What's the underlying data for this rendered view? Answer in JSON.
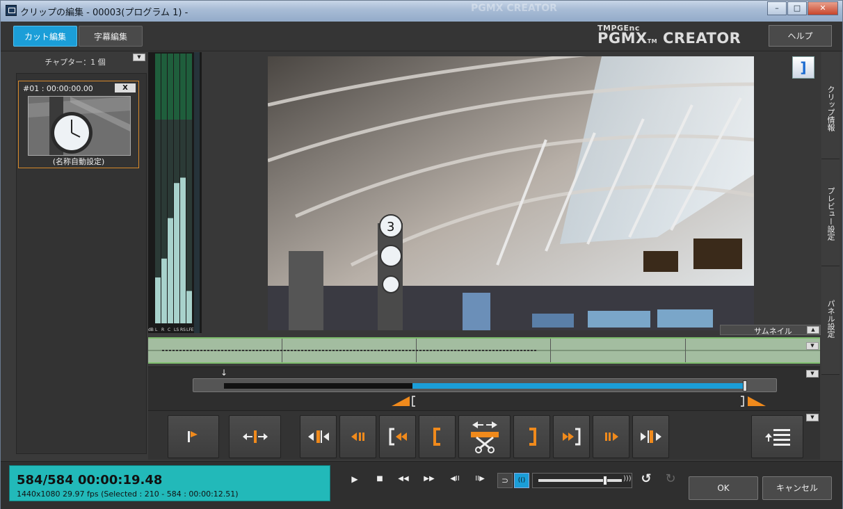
{
  "window": {
    "title": "クリップの編集 - 00003(プログラム 1) -",
    "background_watermarks": [
      "PGMX CREATOR"
    ]
  },
  "toolbar": {
    "tab_cut_label": "カット編集",
    "tab_subtitle_label": "字幕編集",
    "logo_line1": "TMPGEnc",
    "logo_line2": "PGMX",
    "logo_tm": "TM",
    "logo_line3": "CREATOR",
    "help_label": "ヘルプ"
  },
  "chapters": {
    "title": "チャプター：1 個",
    "items": [
      {
        "header": "#01 : 00:00:00.00",
        "close_label": "X",
        "name": "(名称自動設定)"
      }
    ]
  },
  "meter": {
    "scale_label": "dB",
    "channel_labels": [
      "L",
      "R",
      "C",
      "LS",
      "RS",
      "LFE"
    ],
    "levels": [
      0.17,
      0.24,
      0.39,
      0.52,
      0.54,
      0.12
    ]
  },
  "preview": {
    "mark_out_glyph": "]",
    "thumbnail_tab_label": "サムネイル"
  },
  "side_tabs": [
    "クリップ情報",
    "プレビュー設定",
    "パネル設定"
  ],
  "timeline": {
    "selection_start_fraction": 0.36,
    "selection_end_fraction": 1.0,
    "cursor_fraction": 1.0
  },
  "edit_buttons": [
    {
      "name": "set-chapter-button",
      "icon": "flag-icon"
    },
    {
      "name": "split-button",
      "icon": "split-arrows-icon"
    },
    {
      "name": "prev-cut-button",
      "icon": "prev-cut-icon"
    },
    {
      "name": "step-back-button",
      "icon": "step-back-icon"
    },
    {
      "name": "go-start-button",
      "icon": "go-start-icon"
    },
    {
      "name": "set-start-button",
      "icon": "bracket-open-icon"
    },
    {
      "name": "cut-button",
      "icon": "scissors-icon"
    },
    {
      "name": "set-end-button",
      "icon": "bracket-close-icon"
    },
    {
      "name": "go-end-button",
      "icon": "go-end-icon"
    },
    {
      "name": "step-forward-button",
      "icon": "step-forward-icon"
    },
    {
      "name": "next-cut-button",
      "icon": "next-cut-icon"
    },
    {
      "name": "list-button",
      "icon": "list-icon"
    }
  ],
  "status": {
    "frame_time": "584/584  00:00:19.48",
    "info": "1440x1080 29.97 fps  (Selected : 210 - 584 : 00:00:12.51)"
  },
  "playback": {
    "buttons": [
      {
        "name": "play-button",
        "glyph": "▶"
      },
      {
        "name": "stop-button",
        "glyph": "■"
      },
      {
        "name": "rewind-button",
        "glyph": "◀◀"
      },
      {
        "name": "fast-forward-button",
        "glyph": "▶▶"
      },
      {
        "name": "frame-back-button",
        "glyph": "◀II"
      },
      {
        "name": "frame-forward-button",
        "glyph": "II▶"
      }
    ],
    "loop_glyph": "⊃",
    "audio_glyph": "(()",
    "volume_level": 0.8,
    "undo_glyph": "↺",
    "redo_glyph": "↻"
  },
  "dialog": {
    "ok_label": "OK",
    "cancel_label": "キャンセル"
  },
  "colors": {
    "accent": "#1b9ed8",
    "orange": "#f08a1c",
    "status_bg": "#22b9b9"
  }
}
